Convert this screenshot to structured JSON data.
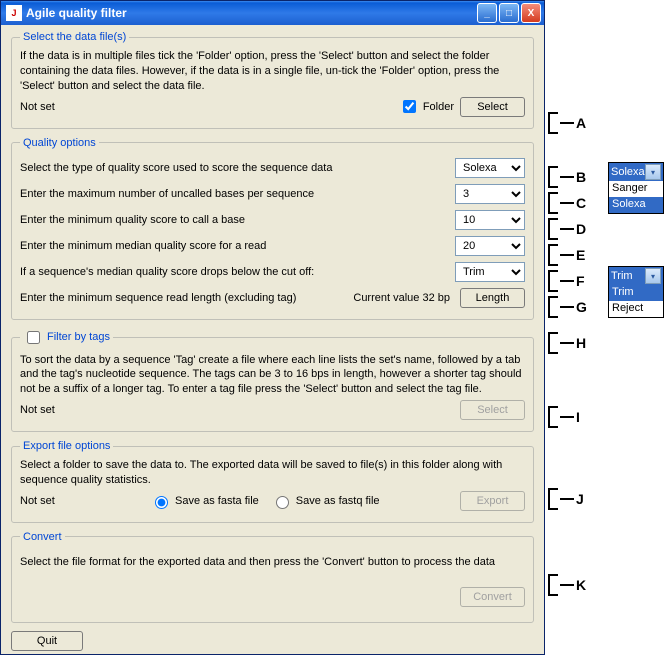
{
  "window": {
    "title": "Agile quality filter"
  },
  "section1": {
    "legend": "Select the data file(s)",
    "desc": "If the data is in multiple files tick the 'Folder' option, press the 'Select' button and select the folder containing the data files. However, if the data is in a single file, un-tick the 'Folder' option, press the 'Select' button and select the data file.",
    "status": "Not set",
    "folder_label": "Folder",
    "select_btn": "Select"
  },
  "section2": {
    "legend": "Quality options",
    "row_type": "Select the type of quality score used to score the sequence data",
    "type_value": "Solexa",
    "row_uncalled": "Enter the maximum number of uncalled bases per sequence",
    "uncalled_value": "3",
    "row_minq": "Enter the minimum quality score to call a base",
    "minq_value": "10",
    "row_median": "Enter the minimum median quality score for a read",
    "median_value": "20",
    "row_cutoff": "If a sequence's median quality score drops below the cut off:",
    "cutoff_value": "Trim",
    "row_length": "Enter the minimum sequence read length (excluding tag)",
    "length_info": "Current value 32 bp",
    "length_btn": "Length"
  },
  "section3": {
    "legend": "Filter by tags",
    "desc": "To sort the data by a sequence 'Tag' create a file where each line lists the set's name, followed by a tab and the tag's nucleotide sequence. The tags can be 3 to 16 bps in length, however a shorter tag should not be a suffix of a longer tag. To enter a tag file press the 'Select' button and select the tag file.",
    "status": "Not set",
    "select_btn": "Select"
  },
  "section4": {
    "legend": "Export file options",
    "desc": "Select a folder to save the data to. The exported data will be saved to file(s) in this folder along with sequence quality statistics.",
    "status": "Not set",
    "radio_fasta": "Save as fasta file",
    "radio_fastq": "Save as fastq file",
    "export_btn": "Export"
  },
  "section5": {
    "legend": "Convert",
    "desc": "Select the file format for the exported data and then press the 'Convert' button to process the data",
    "convert_btn": "Convert"
  },
  "quit_btn": "Quit",
  "annotations": {
    "A": "A",
    "B": "B",
    "C": "C",
    "D": "D",
    "E": "E",
    "F": "F",
    "G": "G",
    "H": "H",
    "I": "I",
    "J": "J",
    "K": "K"
  },
  "popup_type": {
    "selected": "Solexa",
    "opt1": "Sanger",
    "opt2": "Solexa"
  },
  "popup_cutoff": {
    "selected": "Trim",
    "opt1": "Trim",
    "opt2": "Reject"
  }
}
